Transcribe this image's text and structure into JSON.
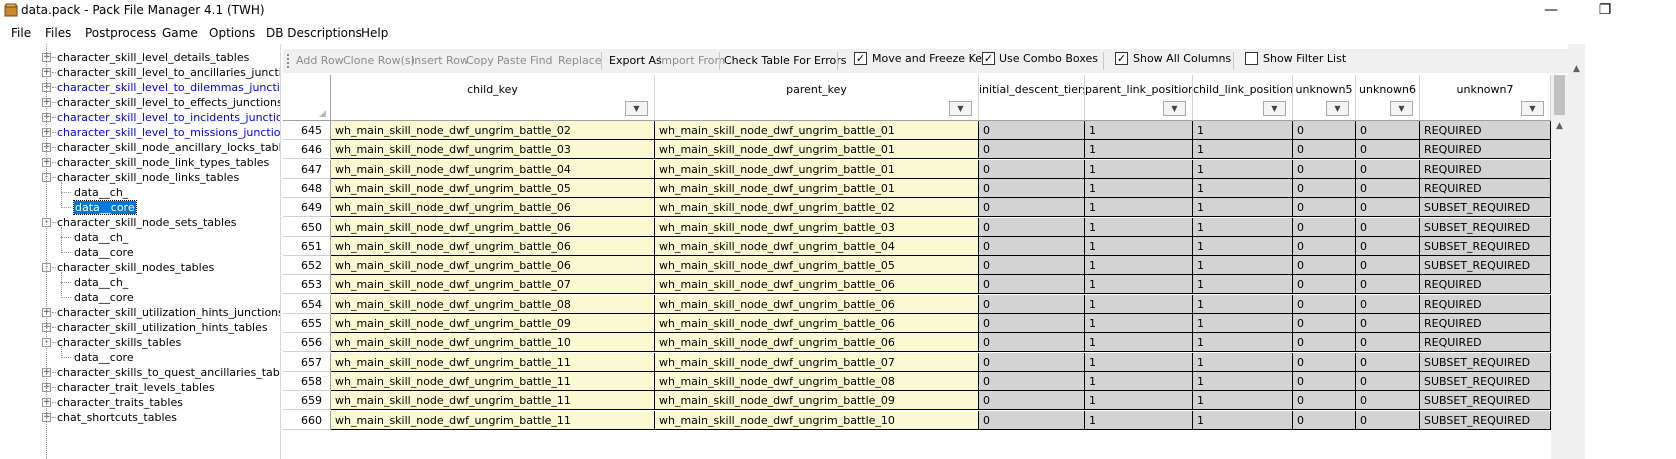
{
  "window": {
    "title": "data.pack - Pack File Manager 4.1 (TWH)",
    "minimize_glyph": "—",
    "restore_glyph": "❐"
  },
  "menu": [
    "File",
    "Files",
    "Postprocess",
    "Game",
    "Options",
    "DB Descriptions",
    "Help"
  ],
  "tree": [
    {
      "label": "character_skill_level_details_tables",
      "level": 1,
      "expander": "+",
      "style": "normal"
    },
    {
      "label": "character_skill_level_to_ancillaries_junctions_",
      "level": 1,
      "expander": "+",
      "style": "normal"
    },
    {
      "label": "character_skill_level_to_dilemmas_junctions_",
      "level": 1,
      "expander": "+",
      "style": "blue"
    },
    {
      "label": "character_skill_level_to_effects_junctions_tal",
      "level": 1,
      "expander": "+",
      "style": "normal"
    },
    {
      "label": "character_skill_level_to_incidents_junctions_",
      "level": 1,
      "expander": "+",
      "style": "blue"
    },
    {
      "label": "character_skill_level_to_missions_junctions_t",
      "level": 1,
      "expander": "+",
      "style": "blue"
    },
    {
      "label": "character_skill_node_ancillary_locks_tables",
      "level": 1,
      "expander": "+",
      "style": "normal"
    },
    {
      "label": "character_skill_node_link_types_tables",
      "level": 1,
      "expander": "+",
      "style": "normal"
    },
    {
      "label": "character_skill_node_links_tables",
      "level": 1,
      "expander": "-",
      "style": "normal"
    },
    {
      "label": "data__ch_",
      "level": 2,
      "expander": "",
      "style": "normal"
    },
    {
      "label": "data__core",
      "level": 2,
      "expander": "",
      "style": "selected"
    },
    {
      "label": "character_skill_node_sets_tables",
      "level": 1,
      "expander": "-",
      "style": "normal"
    },
    {
      "label": "data__ch_",
      "level": 2,
      "expander": "",
      "style": "normal"
    },
    {
      "label": "data__core",
      "level": 2,
      "expander": "",
      "style": "normal"
    },
    {
      "label": "character_skill_nodes_tables",
      "level": 1,
      "expander": "-",
      "style": "normal"
    },
    {
      "label": "data__ch_",
      "level": 2,
      "expander": "",
      "style": "normal"
    },
    {
      "label": "data__core",
      "level": 2,
      "expander": "",
      "style": "normal"
    },
    {
      "label": "character_skill_utilization_hints_junctions_tab",
      "level": 1,
      "expander": "+",
      "style": "normal"
    },
    {
      "label": "character_skill_utilization_hints_tables",
      "level": 1,
      "expander": "+",
      "style": "normal"
    },
    {
      "label": "character_skills_tables",
      "level": 1,
      "expander": "-",
      "style": "normal"
    },
    {
      "label": "data__core",
      "level": 2,
      "expander": "",
      "style": "normal"
    },
    {
      "label": "character_skills_to_quest_ancillaries_tables",
      "level": 1,
      "expander": "+",
      "style": "normal"
    },
    {
      "label": "character_trait_levels_tables",
      "level": 1,
      "expander": "+",
      "style": "normal"
    },
    {
      "label": "character_traits_tables",
      "level": 1,
      "expander": "+",
      "style": "normal"
    },
    {
      "label": "chat_shortcuts_tables",
      "level": 1,
      "expander": "+",
      "style": "normal"
    }
  ],
  "toolbar": {
    "buttons": [
      {
        "label": "Add Row",
        "enabled": false
      },
      {
        "label": "Clone Row(s)",
        "enabled": false
      },
      {
        "label": "Insert Row",
        "enabled": false
      },
      {
        "label": "Copy",
        "enabled": false
      },
      {
        "label": "Paste",
        "enabled": false
      },
      {
        "label": "Find",
        "enabled": false
      },
      {
        "label": "Replace",
        "enabled": false
      },
      {
        "label": "Export As",
        "enabled": true
      },
      {
        "label": "Import From",
        "enabled": false
      },
      {
        "label": "Check Table For Errors",
        "enabled": true
      }
    ],
    "checks": [
      {
        "label": "Move and Freeze Keys",
        "checked": true
      },
      {
        "label": "Use Combo Boxes",
        "checked": true
      },
      {
        "label": "Show All Columns",
        "checked": true
      },
      {
        "label": "Show Filter List",
        "checked": false
      }
    ]
  },
  "grid": {
    "columns": [
      "child_key",
      "parent_key",
      "initial_descent_tiers",
      "parent_link_position",
      "child_link_position",
      "unknown5",
      "unknown6",
      "unknown7"
    ],
    "rows": [
      {
        "n": "645",
        "cells": [
          "wh_main_skill_node_dwf_ungrim_battle_02",
          "wh_main_skill_node_dwf_ungrim_battle_01",
          "0",
          "1",
          "1",
          "0",
          "0",
          "REQUIRED"
        ]
      },
      {
        "n": "646",
        "cells": [
          "wh_main_skill_node_dwf_ungrim_battle_03",
          "wh_main_skill_node_dwf_ungrim_battle_01",
          "0",
          "1",
          "1",
          "0",
          "0",
          "REQUIRED"
        ]
      },
      {
        "n": "647",
        "cells": [
          "wh_main_skill_node_dwf_ungrim_battle_04",
          "wh_main_skill_node_dwf_ungrim_battle_01",
          "0",
          "1",
          "1",
          "0",
          "0",
          "REQUIRED"
        ]
      },
      {
        "n": "648",
        "cells": [
          "wh_main_skill_node_dwf_ungrim_battle_05",
          "wh_main_skill_node_dwf_ungrim_battle_01",
          "0",
          "1",
          "1",
          "0",
          "0",
          "REQUIRED"
        ]
      },
      {
        "n": "649",
        "cells": [
          "wh_main_skill_node_dwf_ungrim_battle_06",
          "wh_main_skill_node_dwf_ungrim_battle_02",
          "0",
          "1",
          "1",
          "0",
          "0",
          "SUBSET_REQUIRED"
        ]
      },
      {
        "n": "650",
        "cells": [
          "wh_main_skill_node_dwf_ungrim_battle_06",
          "wh_main_skill_node_dwf_ungrim_battle_03",
          "0",
          "1",
          "1",
          "0",
          "0",
          "SUBSET_REQUIRED"
        ]
      },
      {
        "n": "651",
        "cells": [
          "wh_main_skill_node_dwf_ungrim_battle_06",
          "wh_main_skill_node_dwf_ungrim_battle_04",
          "0",
          "1",
          "1",
          "0",
          "0",
          "SUBSET_REQUIRED"
        ]
      },
      {
        "n": "652",
        "cells": [
          "wh_main_skill_node_dwf_ungrim_battle_06",
          "wh_main_skill_node_dwf_ungrim_battle_05",
          "0",
          "1",
          "1",
          "0",
          "0",
          "SUBSET_REQUIRED"
        ]
      },
      {
        "n": "653",
        "cells": [
          "wh_main_skill_node_dwf_ungrim_battle_07",
          "wh_main_skill_node_dwf_ungrim_battle_06",
          "0",
          "1",
          "1",
          "0",
          "0",
          "REQUIRED"
        ]
      },
      {
        "n": "654",
        "cells": [
          "wh_main_skill_node_dwf_ungrim_battle_08",
          "wh_main_skill_node_dwf_ungrim_battle_06",
          "0",
          "1",
          "1",
          "0",
          "0",
          "REQUIRED"
        ]
      },
      {
        "n": "655",
        "cells": [
          "wh_main_skill_node_dwf_ungrim_battle_09",
          "wh_main_skill_node_dwf_ungrim_battle_06",
          "0",
          "1",
          "1",
          "0",
          "0",
          "REQUIRED"
        ]
      },
      {
        "n": "656",
        "cells": [
          "wh_main_skill_node_dwf_ungrim_battle_10",
          "wh_main_skill_node_dwf_ungrim_battle_06",
          "0",
          "1",
          "1",
          "0",
          "0",
          "REQUIRED"
        ]
      },
      {
        "n": "657",
        "cells": [
          "wh_main_skill_node_dwf_ungrim_battle_11",
          "wh_main_skill_node_dwf_ungrim_battle_07",
          "0",
          "1",
          "1",
          "0",
          "0",
          "SUBSET_REQUIRED"
        ]
      },
      {
        "n": "658",
        "cells": [
          "wh_main_skill_node_dwf_ungrim_battle_11",
          "wh_main_skill_node_dwf_ungrim_battle_08",
          "0",
          "1",
          "1",
          "0",
          "0",
          "SUBSET_REQUIRED"
        ]
      },
      {
        "n": "659",
        "cells": [
          "wh_main_skill_node_dwf_ungrim_battle_11",
          "wh_main_skill_node_dwf_ungrim_battle_09",
          "0",
          "1",
          "1",
          "0",
          "0",
          "SUBSET_REQUIRED"
        ]
      },
      {
        "n": "660",
        "cells": [
          "wh_main_skill_node_dwf_ungrim_battle_11",
          "wh_main_skill_node_dwf_ungrim_battle_10",
          "0",
          "1",
          "1",
          "0",
          "0",
          "SUBSET_REQUIRED"
        ]
      }
    ]
  },
  "colors": {
    "key_cell": "#fafad2",
    "readonly_cell": "#d3d3d3",
    "tree_link": "#0000ee",
    "selection": "#0078d7"
  },
  "icons": {
    "app": "pack-file-icon",
    "dropdown": "chevron-down-icon"
  }
}
